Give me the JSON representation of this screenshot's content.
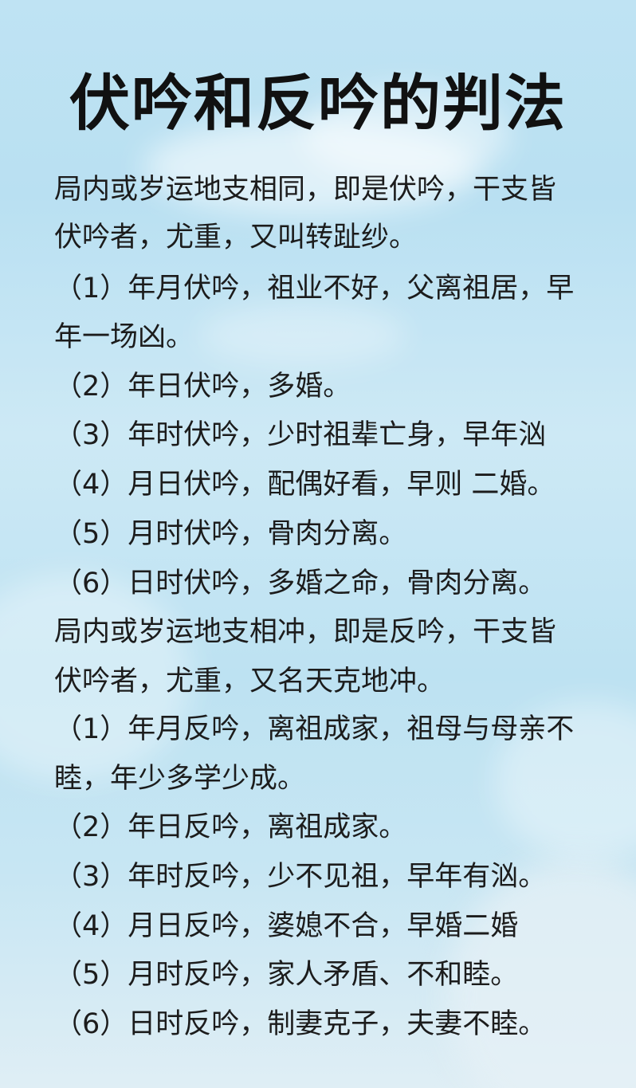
{
  "title": "伏吟和反吟的判法",
  "lines": [
    "局内或岁运地支相同，即是伏吟，干支皆",
    "伏吟者，尤重，又叫转趾纱。",
    "（1）年月伏吟，祖业不好，父离祖居，早",
    "年一场凶。",
    "（2）年日伏吟，多婚。",
    "（3）年时伏吟，少时祖辈亡身，早年汹",
    "（4）月日伏吟，配偶好看，早则 二婚。",
    "（5）月时伏吟，骨肉分离。",
    "（6）日时伏吟，多婚之命，骨肉分离。",
    " 局内或岁运地支相冲，即是反吟，干支皆",
    "伏吟者，尤重，又名天克地冲。",
    "（1）年月反吟，离祖成家，祖母与母亲不",
    "睦，年少多学少成。",
    "（2）年日反吟，离祖成家。",
    "（3）年时反吟，少不见祖，早年有汹。",
    "（4）月日反吟，婆媳不合，早婚二婚",
    "（5）月时反吟，家人矛盾、不和睦。",
    "（6）日时反吟，制妻克子，夫妻不睦。"
  ]
}
